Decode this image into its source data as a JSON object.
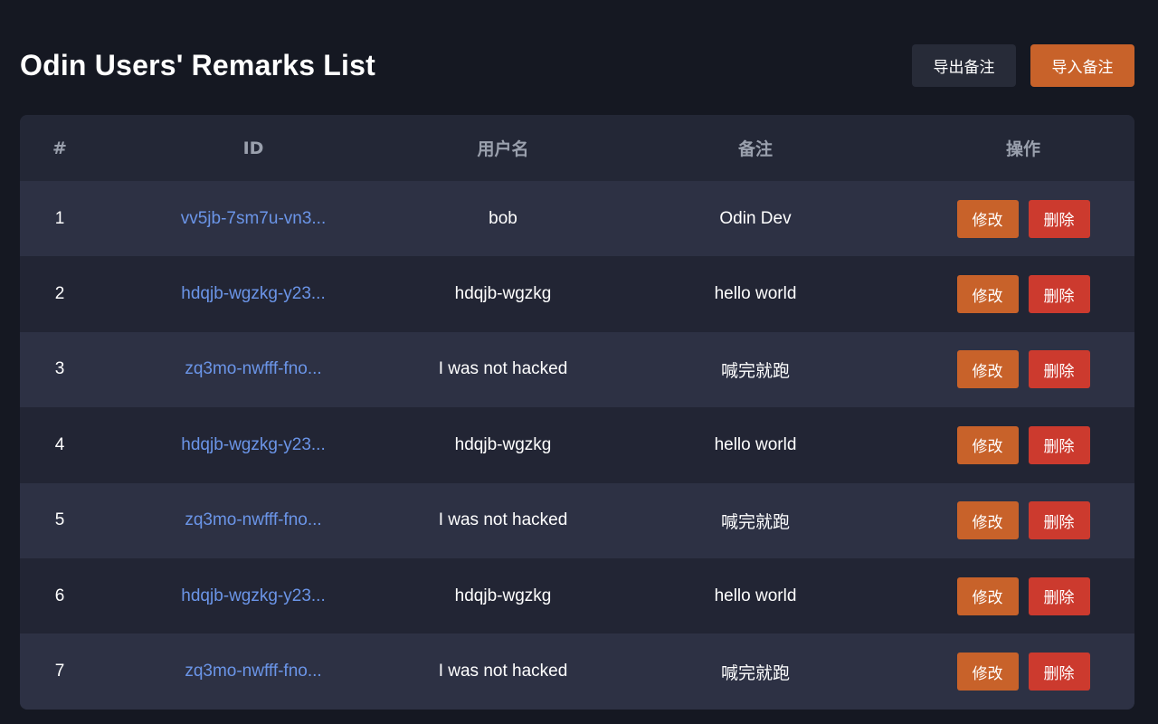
{
  "header": {
    "title": "Odin Users' Remarks List",
    "export_label": "导出备注",
    "import_label": "导入备注"
  },
  "table": {
    "columns": [
      "#",
      "ID",
      "用户名",
      "备注",
      "操作"
    ],
    "rows": [
      {
        "index": "1",
        "id": "vv5jb-7sm7u-vn3...",
        "username": "bob",
        "remark": "Odin Dev",
        "edit_label": "修改",
        "delete_label": "删除"
      },
      {
        "index": "2",
        "id": "hdqjb-wgzkg-y23...",
        "username": "hdqjb-wgzkg",
        "remark": "hello world",
        "edit_label": "修改",
        "delete_label": "删除"
      },
      {
        "index": "3",
        "id": "zq3mo-nwfff-fno...",
        "username": "I was not hacked",
        "remark": "喊完就跑",
        "edit_label": "修改",
        "delete_label": "删除"
      },
      {
        "index": "4",
        "id": "hdqjb-wgzkg-y23...",
        "username": "hdqjb-wgzkg",
        "remark": "hello world",
        "edit_label": "修改",
        "delete_label": "删除"
      },
      {
        "index": "5",
        "id": "zq3mo-nwfff-fno...",
        "username": "I was not hacked",
        "remark": "喊完就跑",
        "edit_label": "修改",
        "delete_label": "删除"
      },
      {
        "index": "6",
        "id": "hdqjb-wgzkg-y23...",
        "username": "hdqjb-wgzkg",
        "remark": "hello world",
        "edit_label": "修改",
        "delete_label": "删除"
      },
      {
        "index": "7",
        "id": "zq3mo-nwfff-fno...",
        "username": "I was not hacked",
        "remark": "喊完就跑",
        "edit_label": "修改",
        "delete_label": "删除"
      }
    ]
  },
  "colors": {
    "background": "#151822",
    "card": "#232736",
    "row_alt": "#2d3144",
    "accent_orange": "#c8622a",
    "danger_red": "#cc3a2e",
    "link_blue": "#6b95e8",
    "header_text": "#9aa0ad"
  }
}
